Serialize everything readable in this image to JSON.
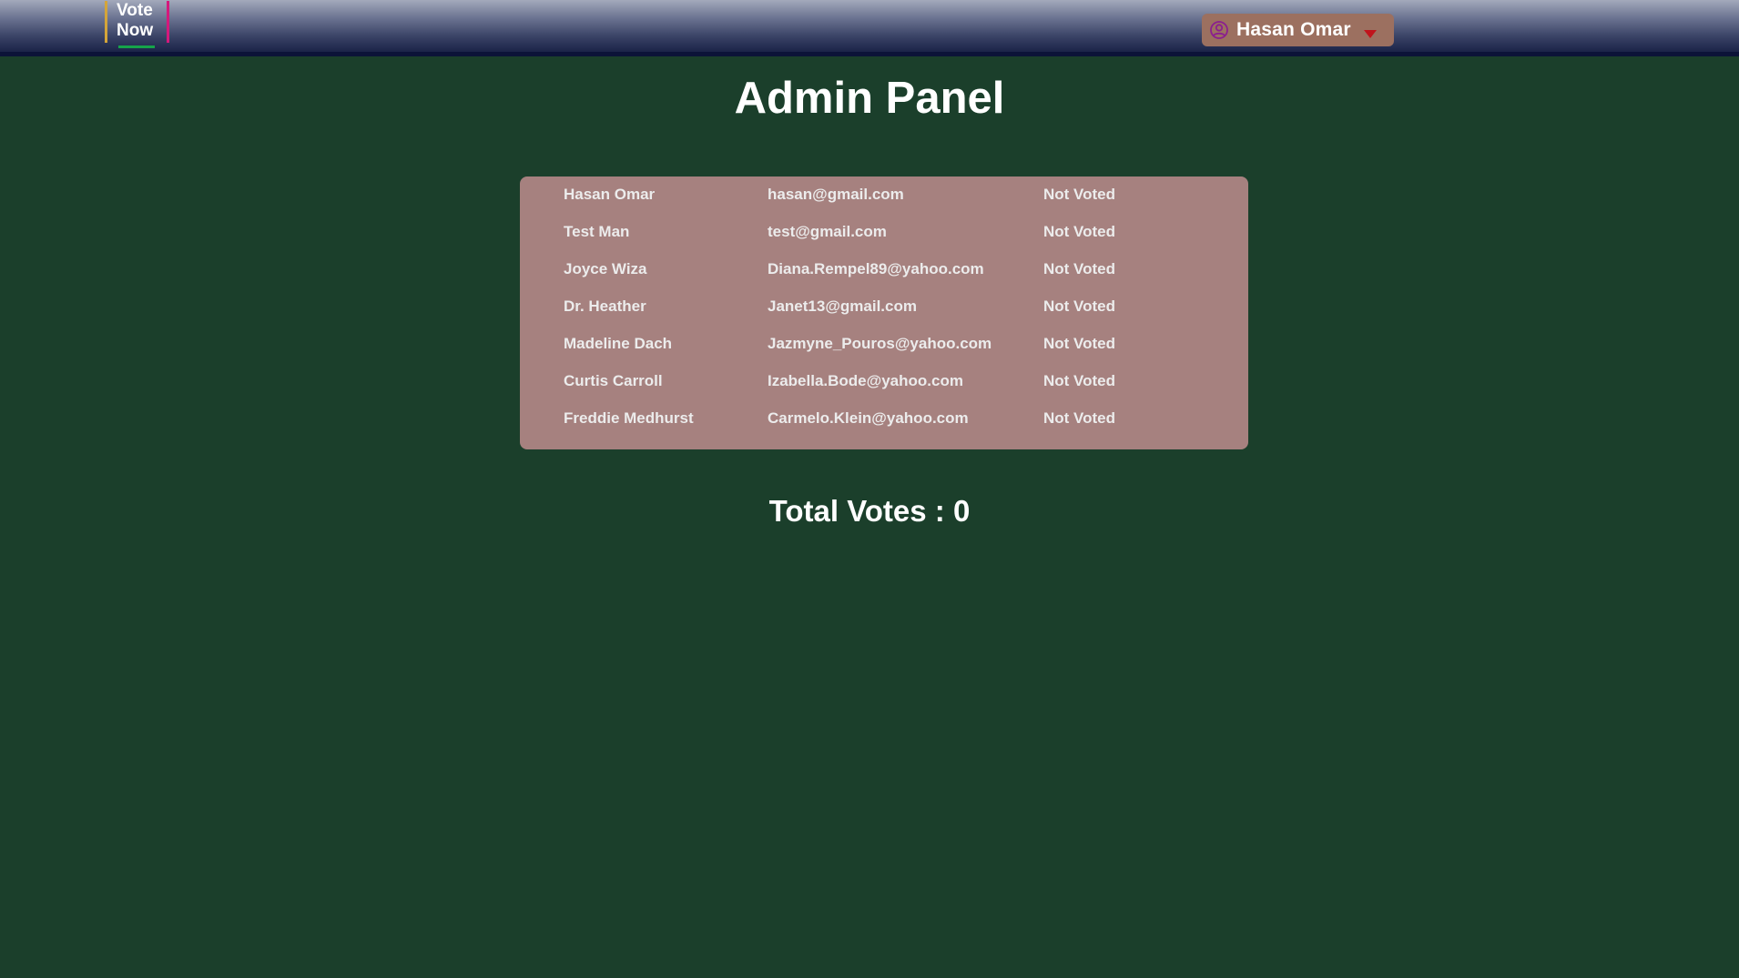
{
  "header": {
    "logo_line1": "Vote",
    "logo_line2": "Now",
    "user_name": "Hasan Omar"
  },
  "main": {
    "title": "Admin Panel",
    "users": [
      {
        "name": "Hasan Omar",
        "email": "hasan@gmail.com",
        "status": "Not Voted"
      },
      {
        "name": "Test Man",
        "email": "test@gmail.com",
        "status": "Not Voted"
      },
      {
        "name": "Joyce Wiza",
        "email": "Diana.Rempel89@yahoo.com",
        "status": "Not Voted"
      },
      {
        "name": "Dr. Heather",
        "email": "Janet13@gmail.com",
        "status": "Not Voted"
      },
      {
        "name": "Madeline Dach",
        "email": "Jazmyne_Pouros@yahoo.com",
        "status": "Not Voted"
      },
      {
        "name": "Curtis Carroll",
        "email": "Izabella.Bode@yahoo.com",
        "status": "Not Voted"
      },
      {
        "name": "Freddie Medhurst",
        "email": "Carmelo.Klein@yahoo.com",
        "status": "Not Voted"
      }
    ],
    "total_votes": "Total Votes : 0"
  },
  "colors": {
    "background": "#1b3f2b",
    "panel": "#a6817f",
    "user_menu": "#9c7060",
    "logo_left_bar": "#d4a53a",
    "logo_right_bar": "#d4197c",
    "logo_underline": "#16a34a",
    "caret": "#c0141c",
    "user_icon": "#8b1f8f"
  },
  "icons": {
    "user": "user-circle-icon",
    "dropdown": "caret-down-icon"
  }
}
